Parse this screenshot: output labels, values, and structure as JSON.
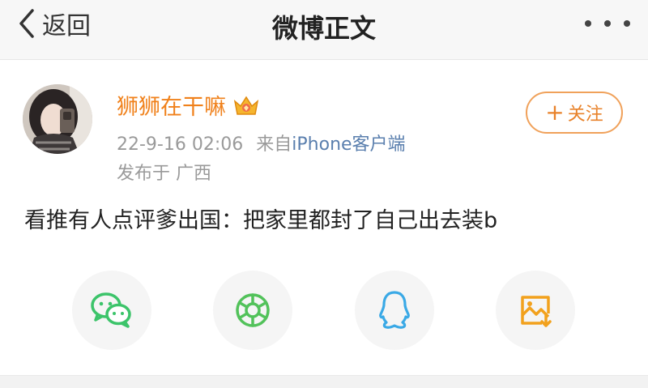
{
  "nav": {
    "back_label": "返回",
    "title": "微博正文"
  },
  "post": {
    "username": "狮狮在干嘛",
    "date": "22-9-16 02:06",
    "source_prefix": "来自",
    "source": "iPhone客户端",
    "location": "发布于 广西",
    "follow_label": "关注",
    "text": "看推有人点评爹出国：把家里都封了自己出去装b"
  },
  "share": {
    "items": [
      "wechat-icon",
      "moments-icon",
      "qq-icon",
      "save-image-icon"
    ]
  },
  "colors": {
    "username": "#f0811b",
    "follow_border": "#f0a15a",
    "source_link": "#5a7fae",
    "wechat": "#3cc46a",
    "moments": "#52c25a",
    "qq": "#3aa9e6",
    "save_image": "#f2a11d"
  }
}
